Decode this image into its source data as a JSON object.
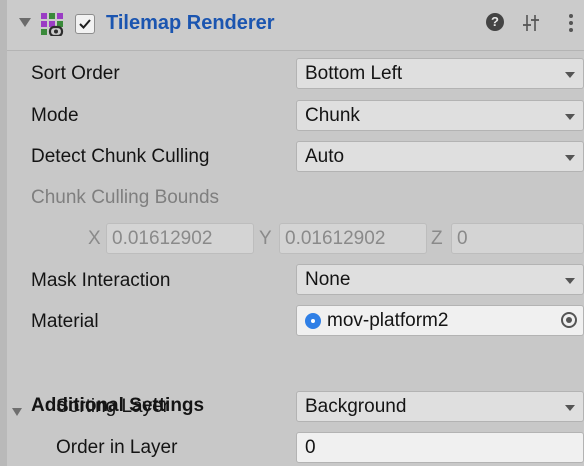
{
  "header": {
    "title": "Tilemap Renderer",
    "enabled": true,
    "help_glyph": "?"
  },
  "properties": {
    "sort_order": {
      "label": "Sort Order",
      "value": "Bottom Left"
    },
    "mode": {
      "label": "Mode",
      "value": "Chunk"
    },
    "detect_chunk_culling": {
      "label": "Detect Chunk Culling",
      "value": "Auto"
    },
    "chunk_culling_bounds": {
      "label": "Chunk Culling Bounds",
      "x_label": "X",
      "x_value": "0.01612902",
      "y_label": "Y",
      "y_value": "0.01612902",
      "z_label": "Z",
      "z_value": "0"
    },
    "mask_interaction": {
      "label": "Mask Interaction",
      "value": "None"
    },
    "material": {
      "label": "Material",
      "value": "mov-platform2"
    }
  },
  "additional_settings": {
    "title": "Additional Settings",
    "sorting_layer": {
      "label": "Sorting Layer",
      "value": "Background"
    },
    "order_in_layer": {
      "label": "Order in Layer",
      "value": "0"
    }
  },
  "colors": {
    "panel_bg": "#c8c8c8",
    "title_blue": "#1b55b0",
    "object_icon": "#2f7fe6"
  },
  "icons": {
    "fold": "triangle-down-icon",
    "component": "tilemap-renderer-icon",
    "help": "help-icon",
    "presets": "presets-icon",
    "menu": "kebab-menu-icon",
    "object_picker": "object-picker-icon"
  }
}
